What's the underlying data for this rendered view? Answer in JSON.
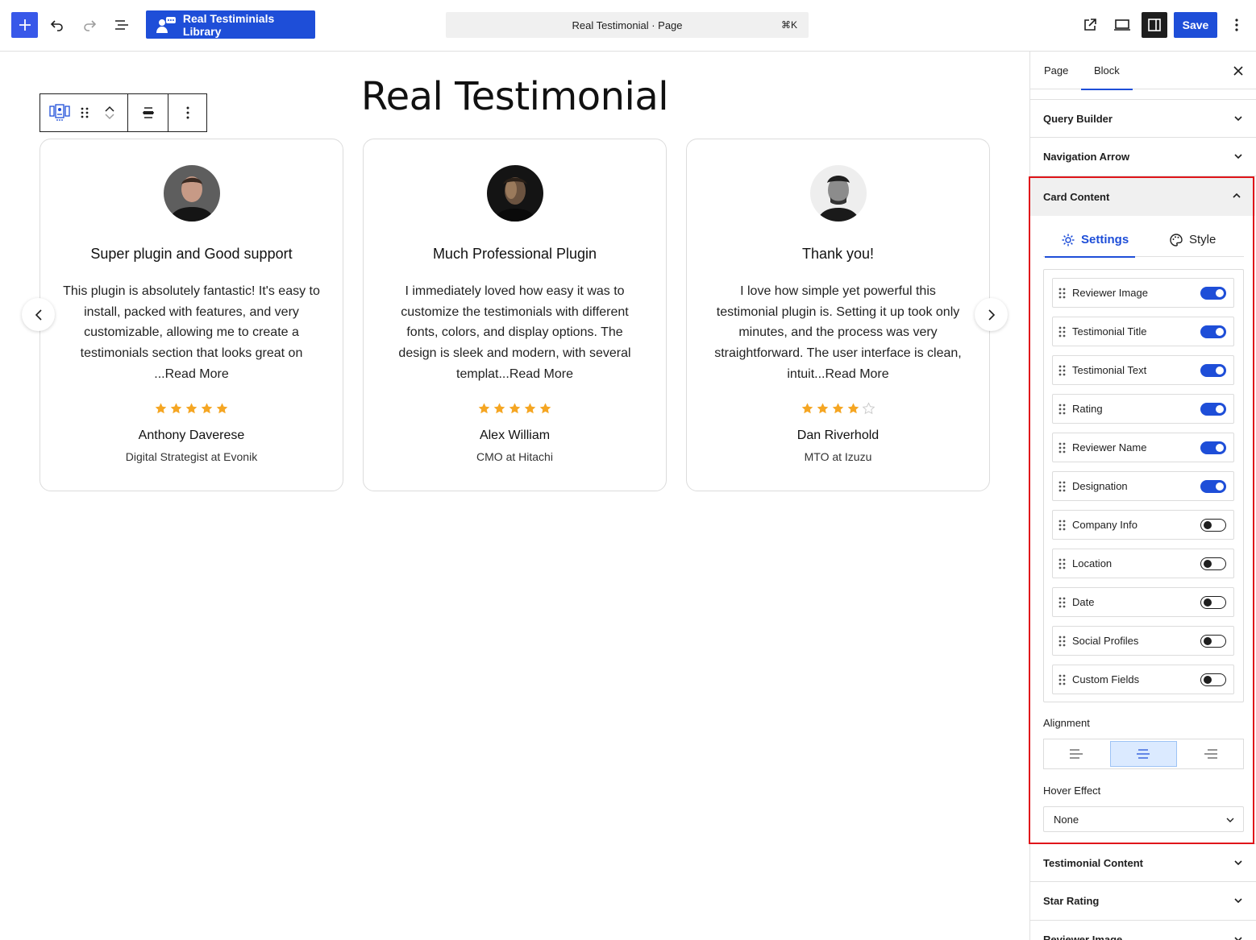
{
  "topbar": {
    "brand_label": "Real Testiminials Library",
    "doc_title": "Real Testimonial · Page",
    "shortcut": "⌘K",
    "save_label": "Save"
  },
  "canvas": {
    "page_heading": "Real Testimonial",
    "cards": [
      {
        "title": "Super plugin and Good support",
        "text": "This plugin is absolutely fantastic! It's easy to install, packed with features, and very customizable, allowing me to create a testimonials section that looks great on ...Read More",
        "rating": 5,
        "name": "Anthony Daverese",
        "role": "Digital Strategist at Evonik"
      },
      {
        "title": "Much Professional Plugin",
        "text": "I immediately loved how easy it was to customize the testimonials with different fonts, colors, and display options. The design is sleek and modern, with several templat...Read More",
        "rating": 5,
        "name": "Alex William",
        "role": "CMO at Hitachi"
      },
      {
        "title": "Thank you!",
        "text": "I love how simple yet powerful this testimonial plugin is. Setting it up took only minutes, and the process was very straightforward. The user interface is clean, intuit...Read More",
        "rating": 4,
        "name": "Dan Riverhold",
        "role": "MTO at Izuzu"
      }
    ],
    "star_color": "#f5a623"
  },
  "sidebar": {
    "tabs": [
      "Page",
      "Block"
    ],
    "active_tab": "Block",
    "panels_top": [
      "Query Builder",
      "Navigation Arrow"
    ],
    "card_content": {
      "title": "Card Content",
      "subtabs": [
        "Settings",
        "Style"
      ],
      "active_subtab": "Settings",
      "toggles": [
        {
          "label": "Reviewer Image",
          "on": true
        },
        {
          "label": "Testimonial Title",
          "on": true
        },
        {
          "label": "Testimonial Text",
          "on": true
        },
        {
          "label": "Rating",
          "on": true
        },
        {
          "label": "Reviewer Name",
          "on": true
        },
        {
          "label": "Designation",
          "on": true
        },
        {
          "label": "Company Info",
          "on": false
        },
        {
          "label": "Location",
          "on": false
        },
        {
          "label": "Date",
          "on": false
        },
        {
          "label": "Social Profiles",
          "on": false
        },
        {
          "label": "Custom Fields",
          "on": false
        }
      ],
      "alignment_label": "Alignment",
      "alignment_selected": "center",
      "hover_effect_label": "Hover Effect",
      "hover_effect_value": "None"
    },
    "panels_bottom": [
      "Testimonial Content",
      "Star Rating",
      "Reviewer Image"
    ]
  },
  "colors": {
    "accent": "#1e4ed8",
    "highlight": "#e0151a"
  }
}
